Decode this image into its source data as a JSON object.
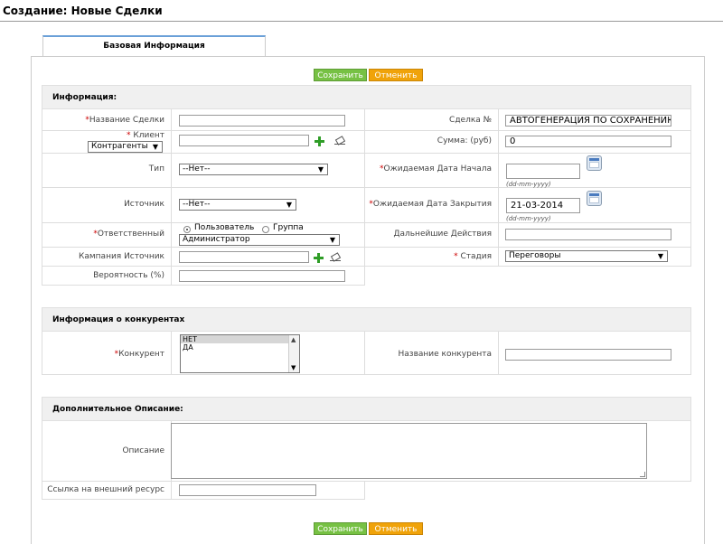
{
  "page": {
    "title": "Создание: Новые Сделки"
  },
  "tabs": [
    {
      "label": "Базовая Информация"
    }
  ],
  "toolbar": {
    "save_label": "Сохранить",
    "cancel_label": "Отменить"
  },
  "sections": {
    "info": "Информация:",
    "competitors": "Информация о конкурентах",
    "extra": "Дополнительное Описание:"
  },
  "fields": {
    "deal_name": {
      "label": "Название Сделки",
      "required": "*",
      "value": ""
    },
    "client": {
      "label": "Клиент",
      "required": "*",
      "type_select": "Контрагенты",
      "value": ""
    },
    "type": {
      "label": "Тип",
      "value": "--Нет--"
    },
    "source": {
      "label": "Источник",
      "value": "--Нет--"
    },
    "owner": {
      "label": "Ответственный",
      "required": "*",
      "radio_user": "Пользователь",
      "radio_group": "Группа",
      "value": "Администратор"
    },
    "campaign": {
      "label": "Кампания Источник",
      "value": ""
    },
    "probability": {
      "label": "Вероятность (%)",
      "value": ""
    },
    "deal_no": {
      "label": "Сделка №",
      "value": "АВТОГЕНЕРАЦИЯ ПО СОХРАНЕНИЮ"
    },
    "amount": {
      "label": "Сумма: (руб)",
      "value": "0"
    },
    "start_date": {
      "label": "Ожидаемая Дата Начала",
      "required": "*",
      "value": "",
      "hint": "(dd-mm-yyyy)"
    },
    "close_date": {
      "label": "Ожидаемая Дата Закрытия",
      "required": "*",
      "value": "21-03-2014",
      "hint": "(dd-mm-yyyy)"
    },
    "next_steps": {
      "label": "Дальнейшие Действия",
      "value": ""
    },
    "stage": {
      "label": "Стадия",
      "required": "*",
      "value": "Переговоры"
    },
    "competitor": {
      "label": "Конкурент",
      "required": "*",
      "options": [
        "НЕТ",
        "ДА"
      ]
    },
    "competitor_name": {
      "label": "Название конкурента",
      "value": ""
    },
    "description": {
      "label": "Описание",
      "value": ""
    },
    "external_link": {
      "label": "Ссылка на внешний ресурс",
      "value": ""
    }
  }
}
